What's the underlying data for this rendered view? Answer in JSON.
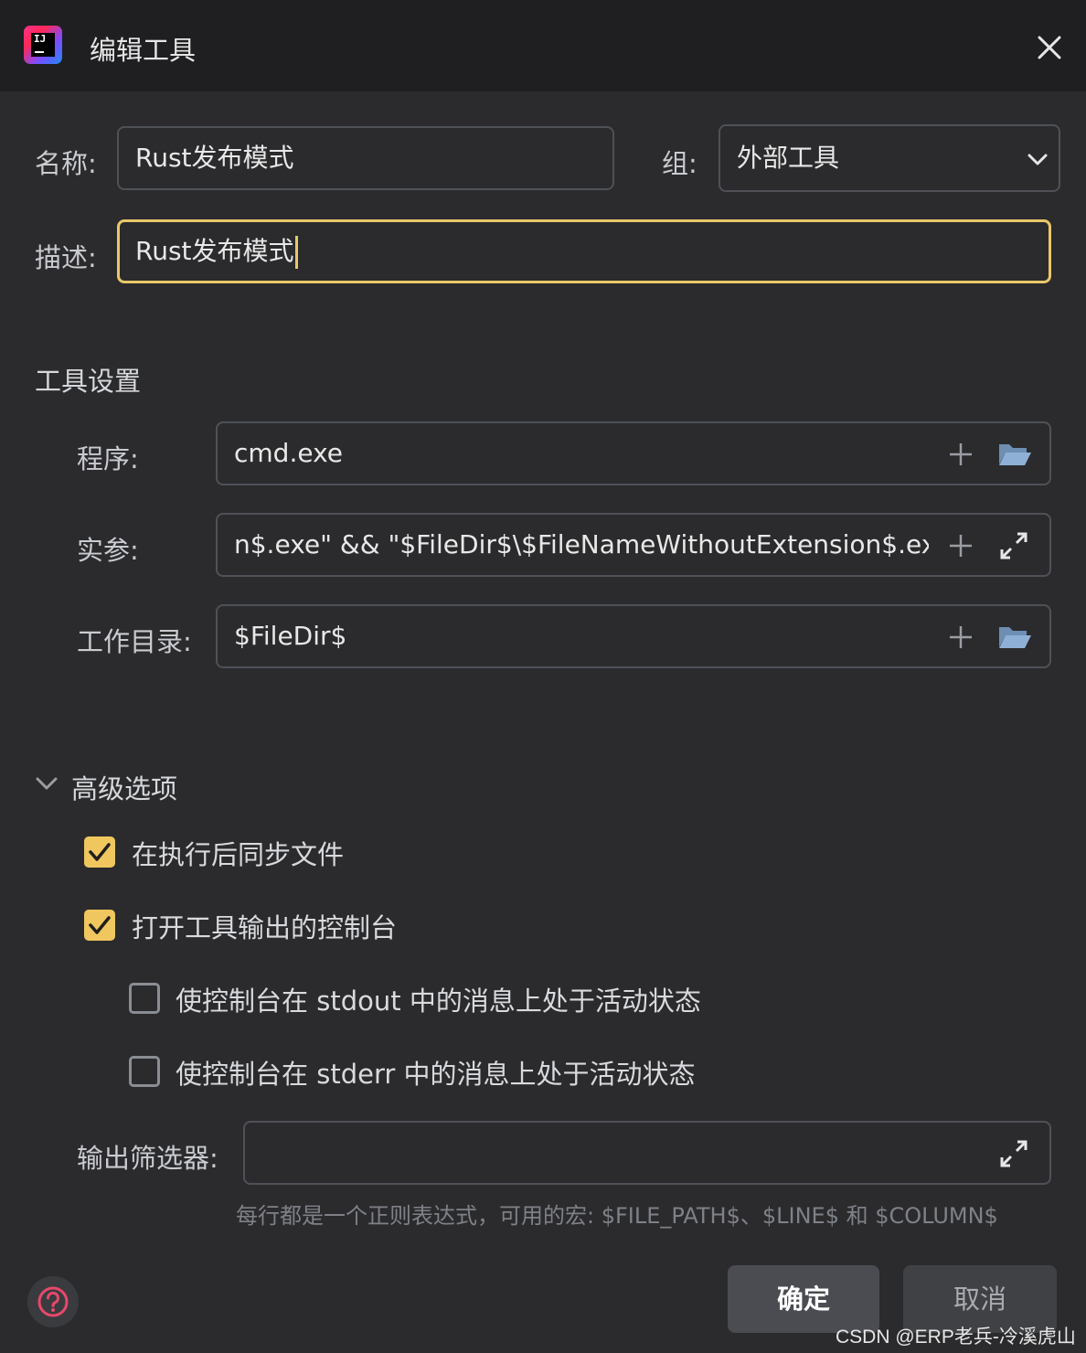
{
  "dialog": {
    "title": "编辑工具"
  },
  "form": {
    "name_label": "名称:",
    "name_value": "Rust发布模式",
    "group_label": "组:",
    "group_value": "外部工具",
    "desc_label": "描述:",
    "desc_value": "Rust发布模式"
  },
  "tool_settings": {
    "title": "工具设置",
    "program_label": "程序:",
    "program_value": "cmd.exe",
    "args_label": "实参:",
    "args_value": "n$.exe\" && \"$FileDir$\\$FileNameWithoutExtension$.exe\"",
    "workdir_label": "工作目录:",
    "workdir_value": "$FileDir$"
  },
  "advanced": {
    "title": "高级选项",
    "options": [
      {
        "label": "在执行后同步文件",
        "checked": true
      },
      {
        "label": "打开工具输出的控制台",
        "checked": true
      },
      {
        "label": "使控制台在 stdout 中的消息上处于活动状态",
        "checked": false
      },
      {
        "label": "使控制台在 stderr 中的消息上处于活动状态",
        "checked": false
      }
    ],
    "filter_label": "输出筛选器:",
    "filter_value": "",
    "hint": "每行都是一个正则表达式，可用的宏: $FILE_PATH$、$LINE$ 和 $COLUMN$"
  },
  "buttons": {
    "ok": "确定",
    "cancel": "取消"
  },
  "app_icon_text": "IJ",
  "watermark": "CSDN @ERP老兵-冷溪虎山",
  "colors": {
    "accent": "#f0c75e",
    "background": "#2b2b2d",
    "titlebar": "#1f1f21",
    "border": "#4e5157"
  },
  "icons": {
    "close": "close-icon",
    "dropdown": "chevron-down-icon",
    "add": "plus-icon",
    "folder": "folder-open-icon",
    "expand": "expand-icon",
    "collapse": "chevron-down-icon",
    "check": "check-icon",
    "help": "help-icon"
  }
}
